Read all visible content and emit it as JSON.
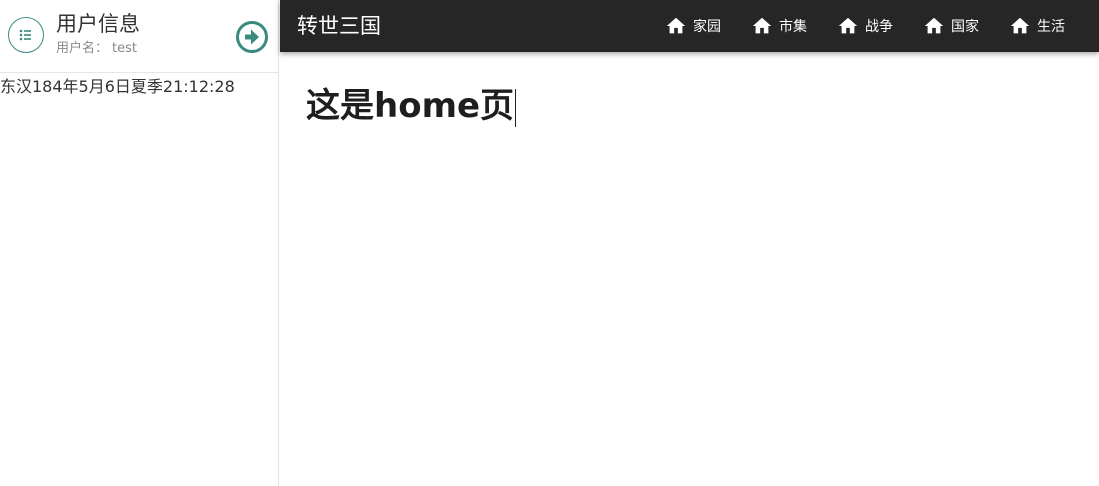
{
  "sidebar": {
    "title": "用户信息",
    "username_label": "用户名：",
    "username": "test",
    "game_time": "东汉184年5月6日夏季21:12:28",
    "icons": {
      "menu": "list-icon",
      "logout": "arrow-right-circle-icon"
    }
  },
  "topbar": {
    "brand": "转世三国",
    "nav": [
      {
        "label": "家园",
        "icon": "home-icon"
      },
      {
        "label": "市集",
        "icon": "home-icon"
      },
      {
        "label": "战争",
        "icon": "home-icon"
      },
      {
        "label": "国家",
        "icon": "home-icon"
      },
      {
        "label": "生活",
        "icon": "home-icon"
      }
    ]
  },
  "main": {
    "title": "这是home页"
  },
  "colors": {
    "topbar_bg": "#262626",
    "accent": "#3a8a80"
  }
}
